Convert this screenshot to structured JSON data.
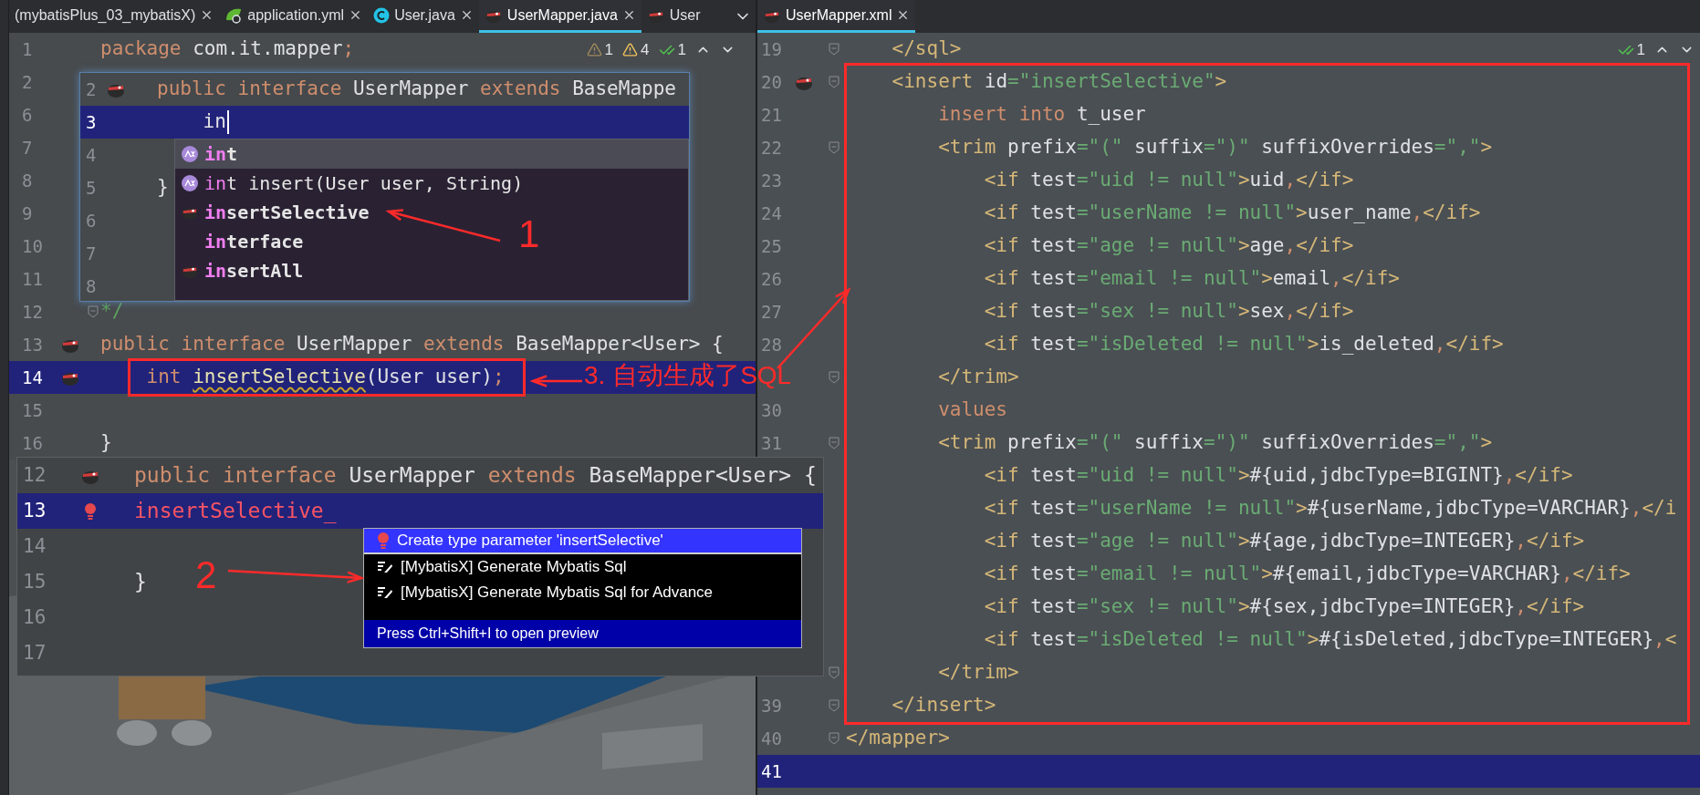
{
  "left_editor": {
    "tabs": [
      {
        "label": "(mybatisPlus_03_mybatisX)",
        "kind": "plain",
        "selected": false,
        "closable": true
      },
      {
        "label": "application.yml",
        "kind": "yml",
        "selected": false,
        "closable": true
      },
      {
        "label": "User.java",
        "kind": "class",
        "selected": false,
        "closable": true
      },
      {
        "label": "UserMapper.java",
        "kind": "mapper",
        "selected": true,
        "closable": true
      },
      {
        "label": "User",
        "kind": "mapper",
        "selected": false,
        "closable": false
      }
    ],
    "inspections": [
      {
        "kind": "weak",
        "count": "1"
      },
      {
        "kind": "warning",
        "count": "4"
      },
      {
        "kind": "ok",
        "count": "1"
      }
    ],
    "lines": [
      {
        "number": "1",
        "tokens": [
          {
            "kind": "kw",
            "text": "package"
          },
          {
            "kind": "plain",
            "text": " com.it.mapper"
          },
          {
            "kind": "kw",
            "text": ";"
          }
        ]
      },
      {
        "number": "2"
      },
      {
        "number": "6"
      },
      {
        "number": "7"
      },
      {
        "number": "8"
      },
      {
        "number": "9"
      },
      {
        "number": "10"
      },
      {
        "number": "11"
      },
      {
        "number": "12",
        "fold": true,
        "tokens": [
          {
            "kind": "comment",
            "text": "*/"
          }
        ]
      },
      {
        "number": "13",
        "kind": "mapper",
        "tokens": [
          {
            "kind": "kw",
            "text": "public interface"
          },
          {
            "kind": "plain",
            "text": " UserMapper "
          },
          {
            "kind": "kw",
            "text": "extends"
          },
          {
            "kind": "plain",
            "text": " BaseMapper<User> {"
          }
        ]
      },
      {
        "number": "14",
        "kind": "mapper",
        "current": true,
        "tokens": [
          {
            "kind": "kw",
            "text": "    int "
          },
          {
            "kind": "warn",
            "text": "insertSelective"
          },
          {
            "kind": "plain",
            "text": "(User user)"
          },
          {
            "kind": "kw",
            "text": ";"
          }
        ]
      },
      {
        "number": "15"
      },
      {
        "number": "16",
        "tokens": [
          {
            "kind": "plain",
            "text": "}"
          }
        ]
      }
    ]
  },
  "completion_inset": {
    "lines": [
      {
        "number": "2",
        "kind": "mapper",
        "tokens": [
          {
            "kind": "kw",
            "text": "public interface"
          },
          {
            "kind": "plain",
            "text": " UserMapper "
          },
          {
            "kind": "kw",
            "text": "extends"
          },
          {
            "kind": "plain",
            "text": " BaseMappe"
          }
        ]
      },
      {
        "number": "3",
        "current": true,
        "tokens": [
          {
            "kind": "plain",
            "text": "    in"
          }
        ]
      },
      {
        "number": "4"
      },
      {
        "number": "5",
        "tokens": [
          {
            "kind": "plain",
            "text": "}"
          }
        ]
      },
      {
        "number": "6"
      },
      {
        "number": "7"
      },
      {
        "number": "8"
      }
    ],
    "items": [
      {
        "kind": "keyword",
        "match": "in",
        "rest": "t",
        "bold": true,
        "selected": true
      },
      {
        "kind": "keyword",
        "match": "in",
        "rest": "t insert(User user, String)",
        "bold": false,
        "selected": false
      },
      {
        "kind": "mapper",
        "match": "in",
        "rest": "sertSelective",
        "bold": true,
        "selected": false
      },
      {
        "kind": "plain",
        "match": "in",
        "rest": "terface",
        "bold": true,
        "selected": false
      },
      {
        "kind": "mapper",
        "match": "in",
        "rest": "sertAll",
        "bold": true,
        "selected": false
      }
    ]
  },
  "quickfix_inset": {
    "lines": [
      {
        "number": "12",
        "kind": "mapper",
        "tokens": [
          {
            "kind": "kw",
            "text": "public interface"
          },
          {
            "kind": "plain",
            "text": " UserMapper "
          },
          {
            "kind": "kw",
            "text": "extends"
          },
          {
            "kind": "plain",
            "text": " BaseMapper<User> {"
          }
        ]
      },
      {
        "number": "13",
        "kind": "error",
        "current": true,
        "tokens": [
          {
            "kind": "err",
            "text": "insertSelective_"
          }
        ]
      },
      {
        "number": "14"
      },
      {
        "number": "15",
        "tokens": [
          {
            "kind": "plain",
            "text": "}"
          }
        ]
      },
      {
        "number": "16"
      },
      {
        "number": "17"
      }
    ],
    "actions": [
      {
        "label": "Create type parameter 'insertSelective'",
        "kind": "fix",
        "selected": true
      },
      {
        "label": "[MybatisX] Generate Mybatis Sql",
        "kind": "generate",
        "selected": false
      },
      {
        "label": "[MybatisX] Generate Mybatis Sql for Advance",
        "kind": "generate",
        "selected": false
      }
    ],
    "footer": "Press Ctrl+Shift+I to open preview"
  },
  "right_editor": {
    "tabs": [
      {
        "label": "UserMapper.xml",
        "kind": "mapper",
        "selected": true,
        "closable": true
      }
    ],
    "inspections": [
      {
        "kind": "ok",
        "count": "1"
      }
    ],
    "lines": [
      {
        "number": "19",
        "fold": true,
        "tokens": [
          {
            "kind": "tag",
            "text": "    </sql>"
          }
        ]
      },
      {
        "number": "20",
        "kind": "mapper",
        "fold": true,
        "tokens": [
          {
            "kind": "tag",
            "text": "    <insert"
          },
          {
            "kind": "plain",
            "text": " id"
          },
          {
            "kind": "str",
            "text": "=\"insertSelective\""
          },
          {
            "kind": "tag",
            "text": ">"
          }
        ]
      },
      {
        "number": "21",
        "tokens": [
          {
            "kind": "kw",
            "text": "        insert into"
          },
          {
            "kind": "plain",
            "text": " t_user"
          }
        ]
      },
      {
        "number": "22",
        "fold": true,
        "tokens": [
          {
            "kind": "tag",
            "text": "        <trim"
          },
          {
            "kind": "plain",
            "text": " prefix"
          },
          {
            "kind": "str",
            "text": "=\"(\""
          },
          {
            "kind": "plain",
            "text": " suffix"
          },
          {
            "kind": "str",
            "text": "=\")\""
          },
          {
            "kind": "plain",
            "text": " suffixOverrides"
          },
          {
            "kind": "str",
            "text": "=\",\""
          },
          {
            "kind": "tag",
            "text": ">"
          }
        ]
      },
      {
        "number": "23",
        "tokens": [
          {
            "kind": "tag",
            "text": "            <if"
          },
          {
            "kind": "plain",
            "text": " test"
          },
          {
            "kind": "str",
            "text": "=\"uid != null\""
          },
          {
            "kind": "tag",
            "text": ">"
          },
          {
            "kind": "plain",
            "text": "uid"
          },
          {
            "kind": "kw",
            "text": ","
          },
          {
            "kind": "tag",
            "text": "</if>"
          }
        ]
      },
      {
        "number": "24",
        "tokens": [
          {
            "kind": "tag",
            "text": "            <if"
          },
          {
            "kind": "plain",
            "text": " test"
          },
          {
            "kind": "str",
            "text": "=\"userName != null\""
          },
          {
            "kind": "tag",
            "text": ">"
          },
          {
            "kind": "plain",
            "text": "user_name"
          },
          {
            "kind": "kw",
            "text": ","
          },
          {
            "kind": "tag",
            "text": "</if>"
          }
        ]
      },
      {
        "number": "25",
        "tokens": [
          {
            "kind": "tag",
            "text": "            <if"
          },
          {
            "kind": "plain",
            "text": " test"
          },
          {
            "kind": "str",
            "text": "=\"age != null\""
          },
          {
            "kind": "tag",
            "text": ">"
          },
          {
            "kind": "plain",
            "text": "age"
          },
          {
            "kind": "kw",
            "text": ","
          },
          {
            "kind": "tag",
            "text": "</if>"
          }
        ]
      },
      {
        "number": "26",
        "tokens": [
          {
            "kind": "tag",
            "text": "            <if"
          },
          {
            "kind": "plain",
            "text": " test"
          },
          {
            "kind": "str",
            "text": "=\"email != null\""
          },
          {
            "kind": "tag",
            "text": ">"
          },
          {
            "kind": "plain",
            "text": "email"
          },
          {
            "kind": "kw",
            "text": ","
          },
          {
            "kind": "tag",
            "text": "</if>"
          }
        ]
      },
      {
        "number": "27",
        "tokens": [
          {
            "kind": "tag",
            "text": "            <if"
          },
          {
            "kind": "plain",
            "text": " test"
          },
          {
            "kind": "str",
            "text": "=\"sex != null\""
          },
          {
            "kind": "tag",
            "text": ">"
          },
          {
            "kind": "plain",
            "text": "sex"
          },
          {
            "kind": "kw",
            "text": ","
          },
          {
            "kind": "tag",
            "text": "</if>"
          }
        ]
      },
      {
        "number": "28",
        "tokens": [
          {
            "kind": "tag",
            "text": "            <if"
          },
          {
            "kind": "plain",
            "text": " test"
          },
          {
            "kind": "str",
            "text": "=\"isDeleted != null\""
          },
          {
            "kind": "tag",
            "text": ">"
          },
          {
            "kind": "plain",
            "text": "is_deleted"
          },
          {
            "kind": "kw",
            "text": ","
          },
          {
            "kind": "tag",
            "text": "</if>"
          }
        ]
      },
      {
        "fold": true,
        "tokens": [
          {
            "kind": "tag",
            "text": "        </trim>"
          }
        ]
      },
      {
        "number": "30",
        "tokens": [
          {
            "kind": "kw",
            "text": "        values"
          }
        ]
      },
      {
        "number": "31",
        "fold": true,
        "tokens": [
          {
            "kind": "tag",
            "text": "        <trim"
          },
          {
            "kind": "plain",
            "text": " prefix"
          },
          {
            "kind": "str",
            "text": "=\"(\""
          },
          {
            "kind": "plain",
            "text": " suffix"
          },
          {
            "kind": "str",
            "text": "=\")\""
          },
          {
            "kind": "plain",
            "text": " suffixOverrides"
          },
          {
            "kind": "str",
            "text": "=\",\""
          },
          {
            "kind": "tag",
            "text": ">"
          }
        ]
      },
      {
        "tokens": [
          {
            "kind": "tag",
            "text": "            <if"
          },
          {
            "kind": "plain",
            "text": " test"
          },
          {
            "kind": "str",
            "text": "=\"uid != null\""
          },
          {
            "kind": "tag",
            "text": ">"
          },
          {
            "kind": "plain",
            "text": "#{uid,jdbcType=BIGINT}"
          },
          {
            "kind": "kw",
            "text": ","
          },
          {
            "kind": "tag",
            "text": "</if>"
          }
        ]
      },
      {
        "tokens": [
          {
            "kind": "tag",
            "text": "            <if"
          },
          {
            "kind": "plain",
            "text": " test"
          },
          {
            "kind": "str",
            "text": "=\"userName != null\""
          },
          {
            "kind": "tag",
            "text": ">"
          },
          {
            "kind": "plain",
            "text": "#{userName,jdbcType=VARCHAR}"
          },
          {
            "kind": "kw",
            "text": ","
          },
          {
            "kind": "tag",
            "text": "</i"
          }
        ]
      },
      {
        "tokens": [
          {
            "kind": "tag",
            "text": "            <if"
          },
          {
            "kind": "plain",
            "text": " test"
          },
          {
            "kind": "str",
            "text": "=\"age != null\""
          },
          {
            "kind": "tag",
            "text": ">"
          },
          {
            "kind": "plain",
            "text": "#{age,jdbcType=INTEGER}"
          },
          {
            "kind": "kw",
            "text": ","
          },
          {
            "kind": "tag",
            "text": "</if>"
          }
        ]
      },
      {
        "tokens": [
          {
            "kind": "tag",
            "text": "            <if"
          },
          {
            "kind": "plain",
            "text": " test"
          },
          {
            "kind": "str",
            "text": "=\"email != null\""
          },
          {
            "kind": "tag",
            "text": ">"
          },
          {
            "kind": "plain",
            "text": "#{email,jdbcType=VARCHAR}"
          },
          {
            "kind": "kw",
            "text": ","
          },
          {
            "kind": "tag",
            "text": "</if>"
          }
        ]
      },
      {
        "tokens": [
          {
            "kind": "tag",
            "text": "            <if"
          },
          {
            "kind": "plain",
            "text": " test"
          },
          {
            "kind": "str",
            "text": "=\"sex != null\""
          },
          {
            "kind": "tag",
            "text": ">"
          },
          {
            "kind": "plain",
            "text": "#{sex,jdbcType=INTEGER}"
          },
          {
            "kind": "kw",
            "text": ","
          },
          {
            "kind": "tag",
            "text": "</if>"
          }
        ]
      },
      {
        "tokens": [
          {
            "kind": "tag",
            "text": "            <if"
          },
          {
            "kind": "plain",
            "text": " test"
          },
          {
            "kind": "str",
            "text": "=\"isDeleted != null\""
          },
          {
            "kind": "tag",
            "text": ">"
          },
          {
            "kind": "plain",
            "text": "#{isDeleted,jdbcType=INTEGER}"
          },
          {
            "kind": "kw",
            "text": ","
          },
          {
            "kind": "tag",
            "text": "<"
          }
        ]
      },
      {
        "fold": true,
        "tokens": [
          {
            "kind": "tag",
            "text": "        </trim>"
          }
        ]
      },
      {
        "number": "39",
        "fold": true,
        "tokens": [
          {
            "kind": "tag",
            "text": "    </insert>"
          }
        ]
      },
      {
        "number": "40",
        "fold": true,
        "tokens": [
          {
            "kind": "tag",
            "text": "</mapper>"
          }
        ]
      },
      {
        "number": "41",
        "current": true
      }
    ]
  },
  "annotations": [
    {
      "text": "1"
    },
    {
      "text": "2"
    },
    {
      "text": "3. 自动生成了SQL"
    }
  ]
}
